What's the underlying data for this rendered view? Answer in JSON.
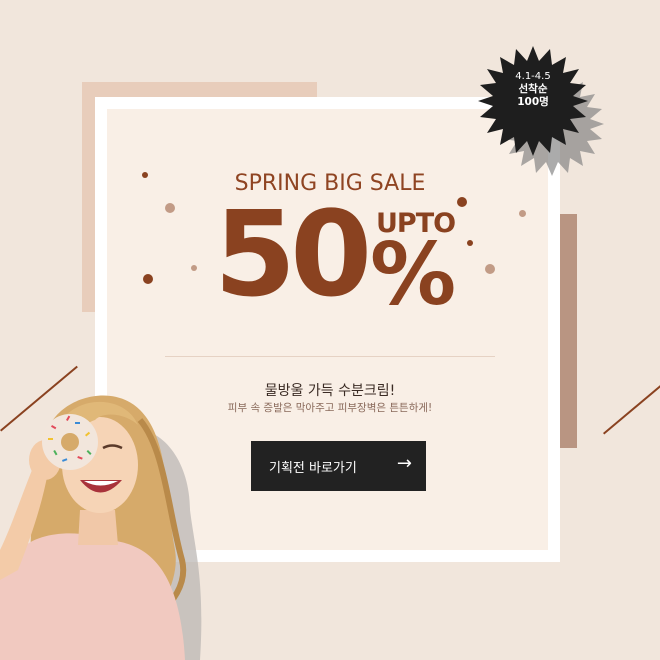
{
  "promo": {
    "headline": "SPRING BIG SALE",
    "discount_number": "50",
    "discount_percent": "%",
    "upto": "UPTO",
    "subtitle": "물방울 가득 수분크림!",
    "description": "피부 속 증발은 막아주고 피부장벽은 튼튼하게!"
  },
  "badge": {
    "dates": "4.1-4.5",
    "line2": "선착순",
    "line3": "100명"
  },
  "cta": {
    "label": "기획전 바로가기",
    "arrow": "→"
  },
  "colors": {
    "background": "#f1e6dc",
    "panel": "#f9efe6",
    "accent_brown": "#8a4220",
    "button": "#222222",
    "badge": "#1e1e1e"
  }
}
